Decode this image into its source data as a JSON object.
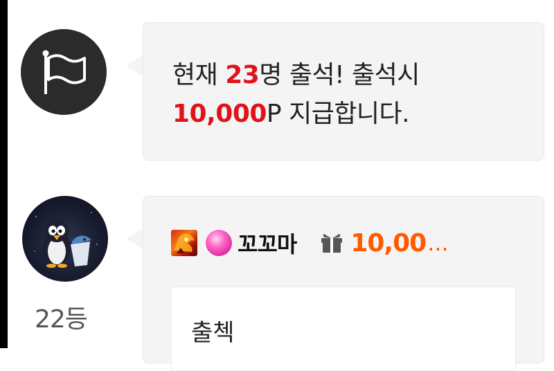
{
  "notice": {
    "icon": "flag-icon",
    "text_before": "현재 ",
    "attendee_count": "23",
    "text_after_count": "명 출석! 출석시",
    "points": "10,000",
    "text_after_points": "P 지급합니다."
  },
  "comment": {
    "avatar": "penguin-avatar",
    "rank_label": "22등",
    "nickname": "꼬꼬마",
    "gift_icon": "gift-icon",
    "gift_amount": "10,00",
    "gift_ellipsis": "...",
    "content": "출첵"
  },
  "colors": {
    "highlight_red": "#e0131b",
    "gift_orange": "#ff5a00",
    "bubble_bg": "#f4f4f4"
  }
}
